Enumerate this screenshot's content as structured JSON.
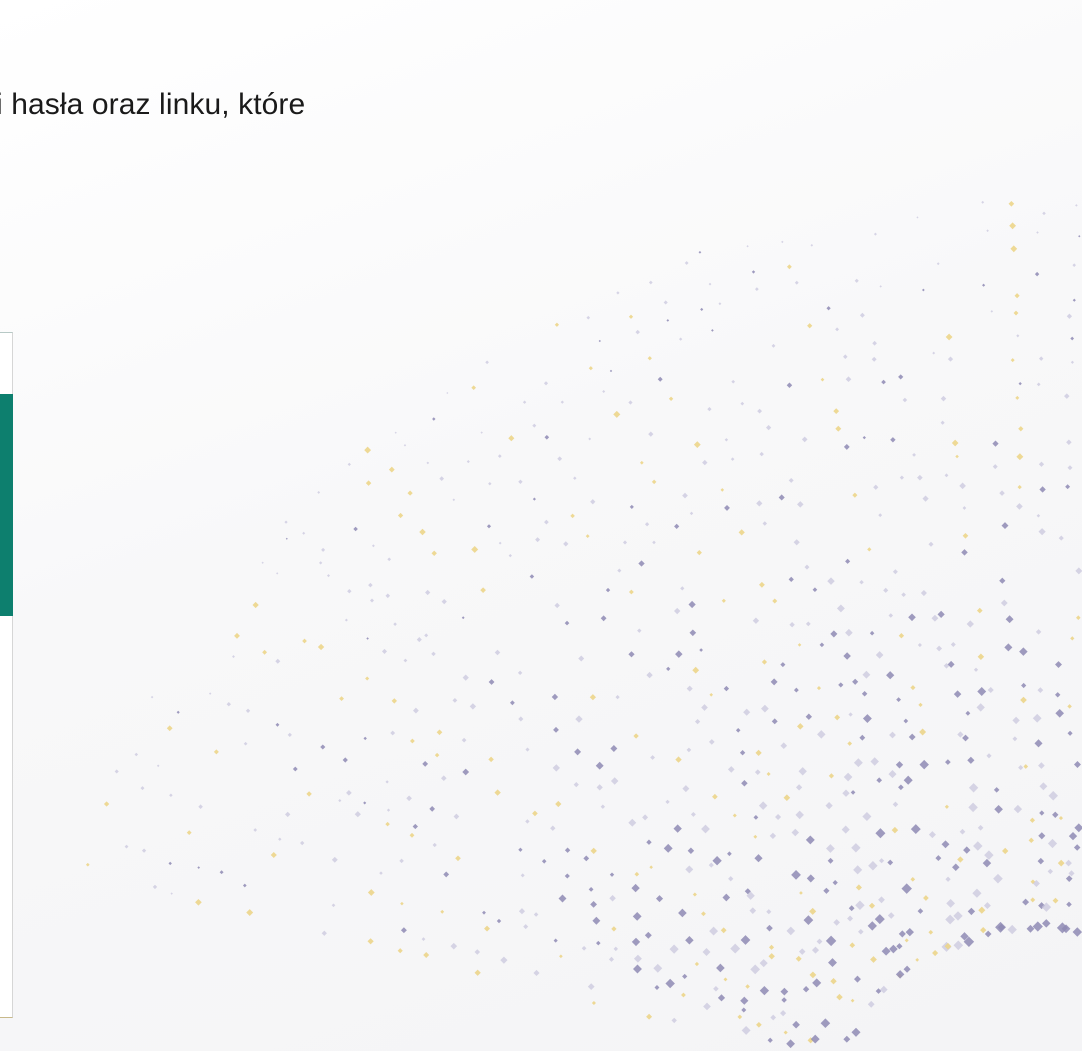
{
  "slide": {
    "visible_text": "i hasła oraz linku, które"
  },
  "colors": {
    "accent_teal": "#0d7f6e",
    "dot_purple": "#8e8ab4",
    "dot_lilac": "#c9c7dd",
    "dot_gold": "#ecd58a"
  },
  "decoration": {
    "pattern": "diamond-dot-burst"
  }
}
